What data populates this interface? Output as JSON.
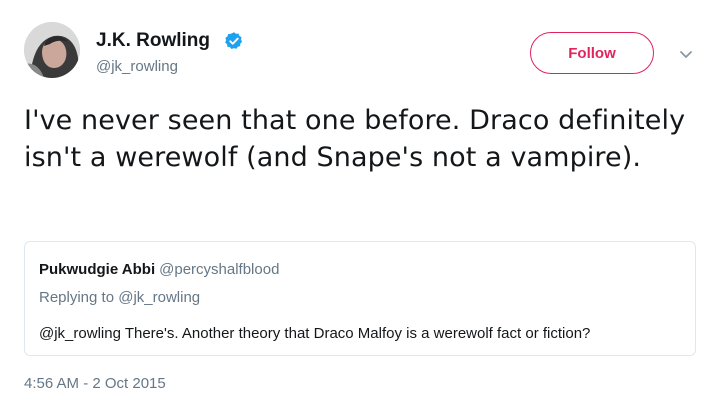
{
  "author": {
    "display_name": "J.K. Rowling",
    "handle": "@jk_rowling",
    "verified_icon": "verified-badge-icon",
    "avatar_icon": "avatar-photo"
  },
  "header": {
    "follow_label": "Follow",
    "menu_icon": "chevron-down-icon"
  },
  "tweet": {
    "text": "I've never seen that one before. Draco definitely isn't a werewolf (and Snape's not a vampire).",
    "timestamp": "4:56 AM - 2 Oct 2015"
  },
  "quoted": {
    "display_name": "Pukwudgie Abbi",
    "handle": "@percyshalfblood",
    "replying_to": "Replying to @jk_rowling",
    "text": "@jk_rowling There's. Another theory that Draco Malfoy is a werewolf fact or fiction?"
  },
  "colors": {
    "follow_accent": "#e0245e",
    "verified_blue": "#1da1f2",
    "secondary_text": "#657786",
    "border": "#e1e8ed"
  }
}
